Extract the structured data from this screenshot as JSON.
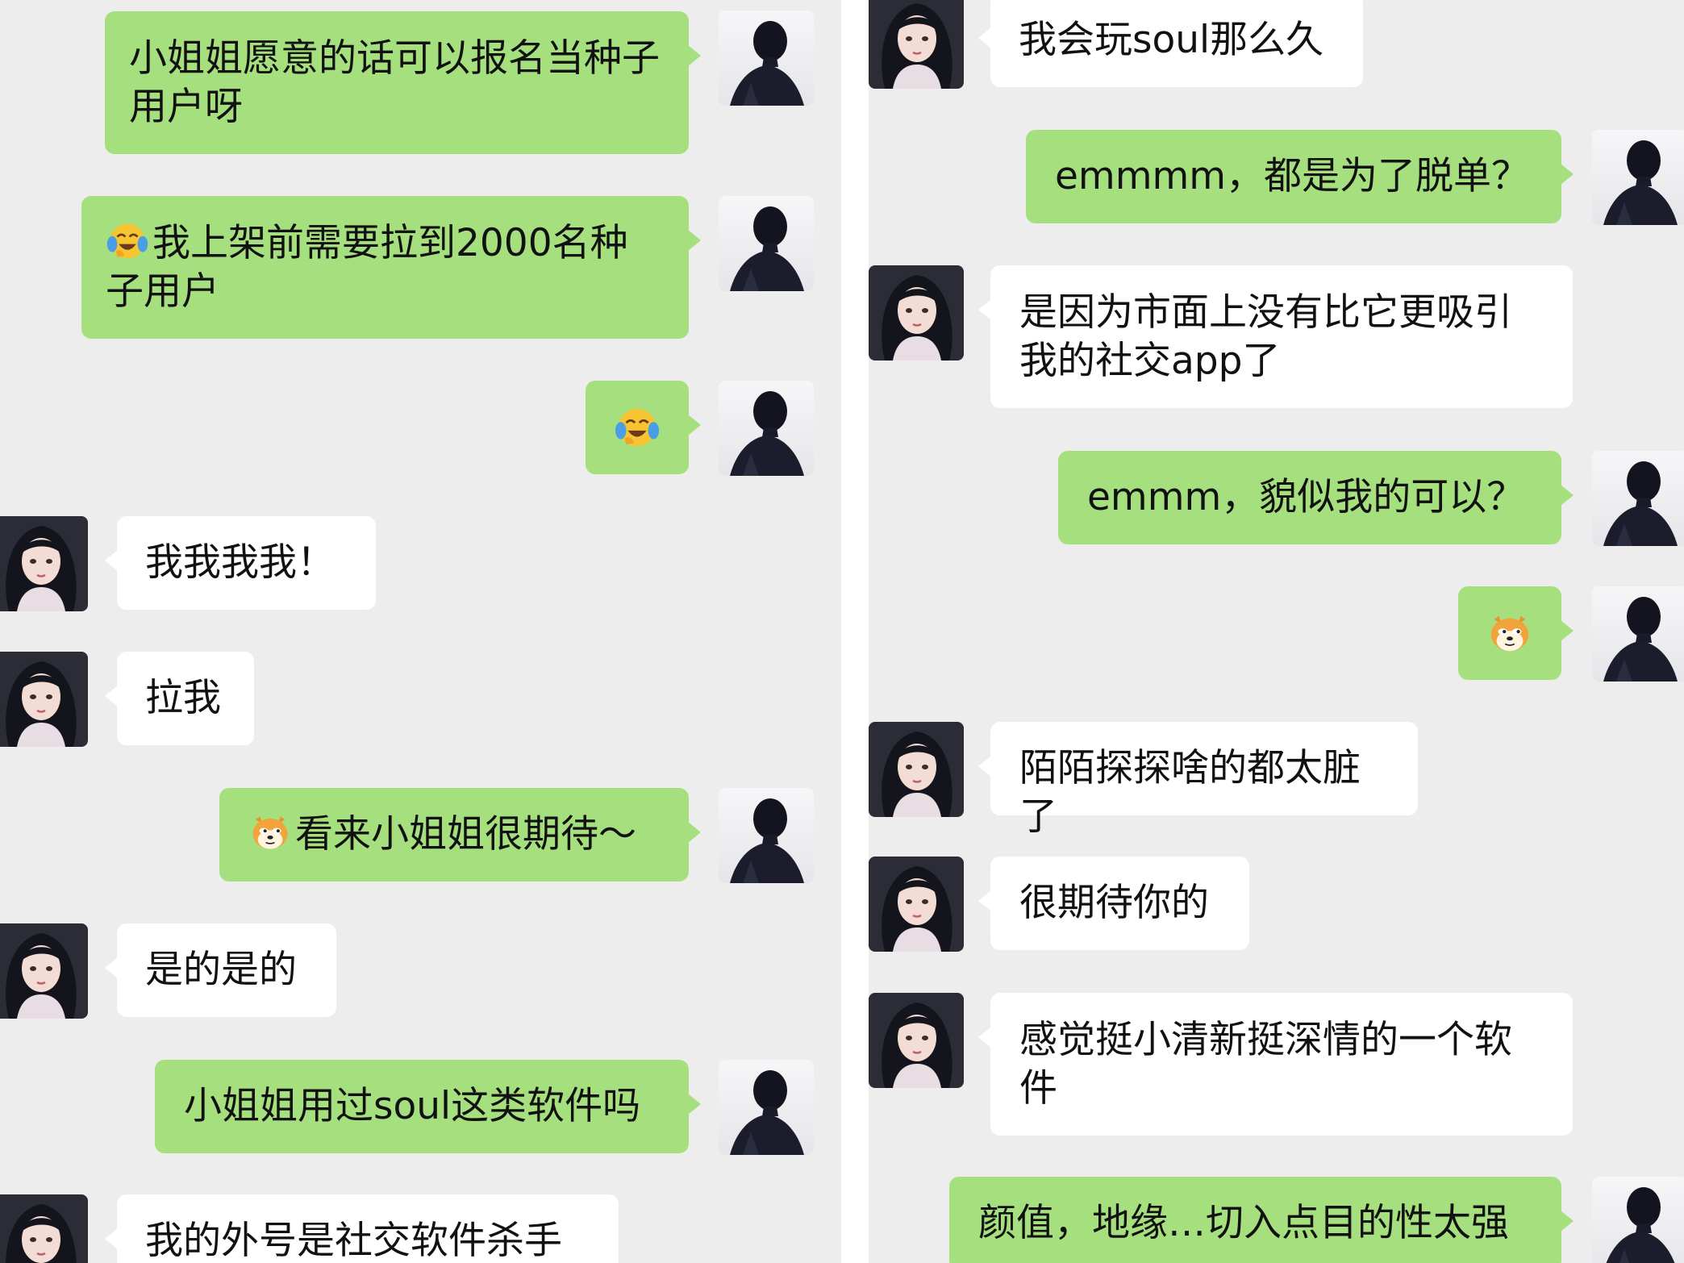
{
  "left_panel": {
    "messages": [
      {
        "side": "out",
        "text": "小姐姐愿意的话可以报名当种子用户呀"
      },
      {
        "side": "out",
        "emoji": "face-with-tears-of-joy",
        "text": "我上架前需要拉到2000名种子用户"
      },
      {
        "side": "out",
        "emoji": "face-with-tears-of-joy",
        "text": ""
      },
      {
        "side": "in",
        "text": "我我我我！"
      },
      {
        "side": "in",
        "text": "拉我"
      },
      {
        "side": "out",
        "emoji": "doge-face",
        "text": "看来小姐姐很期待～"
      },
      {
        "side": "in",
        "text": "是的是的"
      },
      {
        "side": "out",
        "text": "小姐姐用过soul这类软件吗"
      },
      {
        "side": "in",
        "text": "我的外号是社交软件杀手"
      }
    ]
  },
  "right_panel": {
    "messages": [
      {
        "side": "in",
        "text": "我会玩soul那么久"
      },
      {
        "side": "out",
        "text": "emmmm，都是为了脱单？"
      },
      {
        "side": "in",
        "text": "是因为市面上没有比它更吸引我的社交app了"
      },
      {
        "side": "out",
        "text": "emmm，貌似我的可以？"
      },
      {
        "side": "out",
        "emoji": "doge-face",
        "text": ""
      },
      {
        "side": "in",
        "text": "陌陌探探啥的都太脏了"
      },
      {
        "side": "in",
        "text": "很期待你的"
      },
      {
        "side": "in",
        "text": "感觉挺小清新挺深情的一个软件"
      },
      {
        "side": "out",
        "text": "颜值，地缘…切入点目的性太强"
      }
    ]
  },
  "avatars": {
    "self": "silhouette-avatar",
    "contact": "anime-girl-avatar"
  },
  "colors": {
    "background": "#ededed",
    "outgoing_bubble": "#a6e07e",
    "incoming_bubble": "#ffffff",
    "text": "#111111"
  }
}
